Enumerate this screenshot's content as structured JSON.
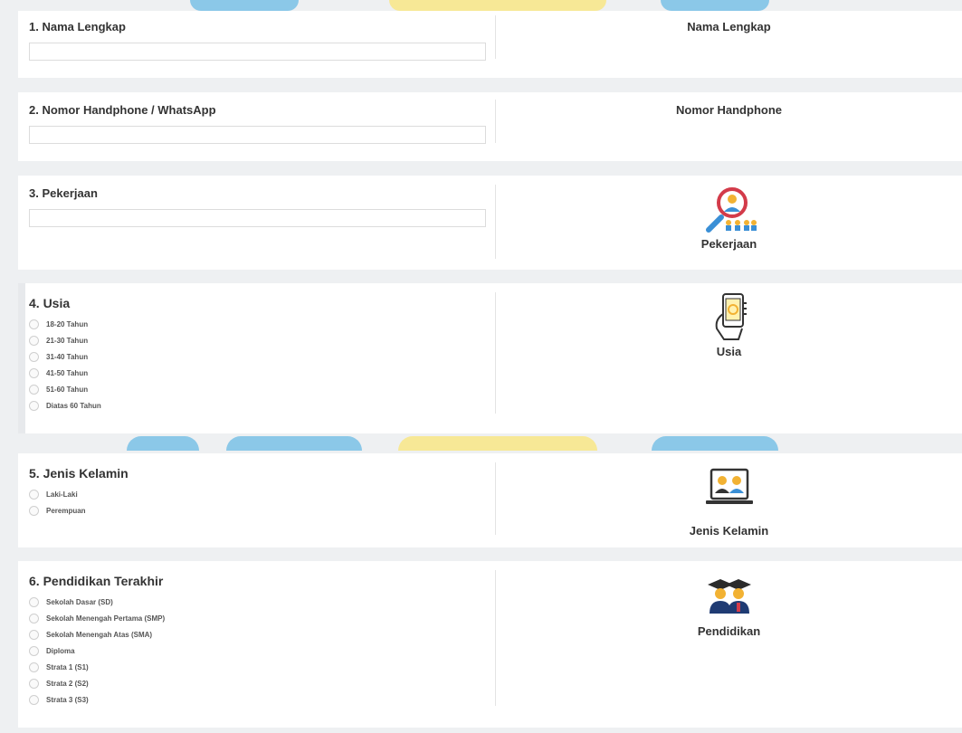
{
  "colors": {
    "accent_blue": "#3aa8e0",
    "accent_yellow": "#ffe24a",
    "page_bg": "#eef0f2"
  },
  "q1": {
    "title": "1. Nama Lengkap",
    "value": "",
    "right_label": "Nama Lengkap"
  },
  "q2": {
    "title": "2. Nomor Handphone / WhatsApp",
    "value": "",
    "right_label": "Nomor Handphone"
  },
  "q3": {
    "title": "3. Pekerjaan",
    "value": "",
    "right_label": "Pekerjaan",
    "icon": "job-search-icon"
  },
  "q4": {
    "title": "4. Usia",
    "options": [
      "18-20 Tahun",
      "21-30 Tahun",
      "31-40 Tahun",
      "41-50 Tahun",
      "51-60 Tahun",
      "Diatas 60 Tahun"
    ],
    "right_label": "Usia",
    "icon": "phone-hand-icon"
  },
  "q5": {
    "title": "5. Jenis Kelamin",
    "options": [
      "Laki-Laki",
      "Perempuan"
    ],
    "right_label": "Jenis Kelamin",
    "icon": "laptop-people-icon"
  },
  "q6": {
    "title": "6. Pendidikan Terakhir",
    "options": [
      "Sekolah Dasar (SD)",
      "Sekolah Menengah Pertama (SMP)",
      "Sekolah Menengah Atas (SMA)",
      "Diploma",
      "Strata 1 (S1)",
      "Strata 2 (S2)",
      "Strata 3 (S3)"
    ],
    "right_label": "Pendidikan",
    "icon": "graduates-icon"
  }
}
